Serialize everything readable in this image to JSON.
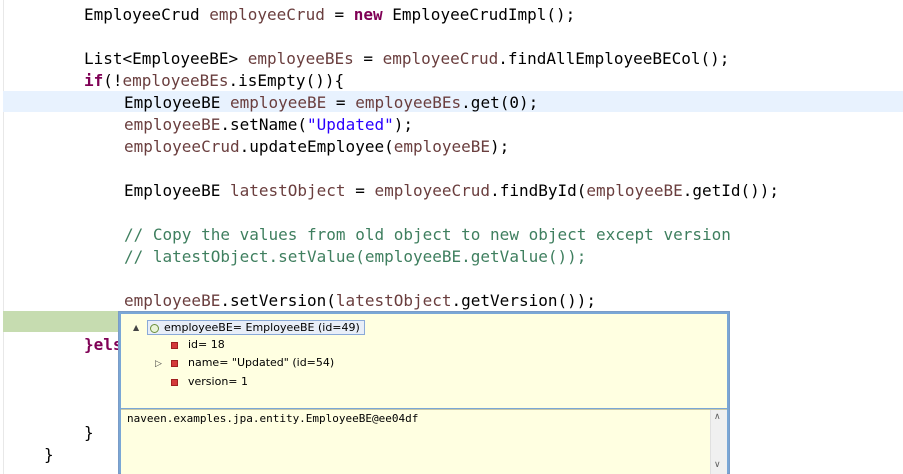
{
  "editor": {
    "lines": [
      {
        "segments": [
          {
            "t": "EmployeeCrud ",
            "c": ""
          },
          {
            "t": "employeeCrud",
            "c": "fld"
          },
          {
            "t": " = ",
            "c": ""
          },
          {
            "t": "new",
            "c": "kw"
          },
          {
            "t": " EmployeeCrudImpl();",
            "c": ""
          }
        ]
      },
      {
        "segments": [
          {
            "t": "List<EmployeeBE> ",
            "c": ""
          },
          {
            "t": "employeeBEs",
            "c": "fld"
          },
          {
            "t": " = ",
            "c": ""
          },
          {
            "t": "employeeCrud",
            "c": "fld"
          },
          {
            "t": ".findAllEmployeeBECol();",
            "c": ""
          }
        ]
      },
      {
        "segments": [
          {
            "t": "if",
            "c": "kw"
          },
          {
            "t": "(!",
            "c": ""
          },
          {
            "t": "employeeBEs",
            "c": "fld"
          },
          {
            "t": ".isEmpty()){",
            "c": ""
          }
        ]
      },
      {
        "segments": [
          {
            "t": "EmployeeBE ",
            "c": ""
          },
          {
            "t": "employeeBE",
            "c": "fld"
          },
          {
            "t": " = ",
            "c": ""
          },
          {
            "t": "employeeBEs",
            "c": "fld"
          },
          {
            "t": ".get(0);",
            "c": ""
          }
        ]
      },
      {
        "segments": [
          {
            "t": "employeeBE",
            "c": "fld"
          },
          {
            "t": ".setName(",
            "c": ""
          },
          {
            "t": "\"Updated\"",
            "c": "str"
          },
          {
            "t": ");",
            "c": ""
          }
        ]
      },
      {
        "segments": [
          {
            "t": "employeeCrud",
            "c": "fld"
          },
          {
            "t": ".updateEmployee(",
            "c": ""
          },
          {
            "t": "employeeBE",
            "c": "fld"
          },
          {
            "t": ");",
            "c": ""
          }
        ]
      },
      {
        "segments": [
          {
            "t": "EmployeeBE ",
            "c": ""
          },
          {
            "t": "latestObject",
            "c": "fld"
          },
          {
            "t": " = ",
            "c": ""
          },
          {
            "t": "employeeCrud",
            "c": "fld"
          },
          {
            "t": ".findById(",
            "c": ""
          },
          {
            "t": "employeeBE",
            "c": "fld"
          },
          {
            "t": ".getId());",
            "c": ""
          }
        ]
      },
      {
        "segments": [
          {
            "t": "// Copy the values from old object to new object except version",
            "c": "cmt"
          }
        ]
      },
      {
        "segments": [
          {
            "t": "// latestObject.setValue(employeeBE.getValue());",
            "c": "cmt"
          }
        ]
      },
      {
        "segments": [
          {
            "t": "employeeBE",
            "c": "fld"
          },
          {
            "t": ".setVersion(",
            "c": ""
          },
          {
            "t": "latestObject",
            "c": "fld"
          },
          {
            "t": ".getVersion());",
            "c": ""
          }
        ]
      },
      {
        "segments": [
          {
            "t": "}els",
            "c": "kw"
          }
        ]
      },
      {
        "segments": [
          {
            "t": "}",
            "c": ""
          }
        ]
      },
      {
        "segments": [
          {
            "t": "}",
            "c": ""
          }
        ]
      }
    ],
    "highlight_color": "#e8f2fe",
    "current_line_color": "#c6dcb0"
  },
  "popup": {
    "root_label": "employeeBE= EmployeeBE  (id=49)",
    "children": [
      {
        "label": "id= 18",
        "expandable": false
      },
      {
        "label": "name= \"Updated\" (id=54)",
        "expandable": true
      },
      {
        "label": "version= 1",
        "expandable": false
      }
    ],
    "detail_text": "naveen.examples.jpa.entity.EmployeeBE@ee04df",
    "expand_glyph": "▲",
    "collapsed_glyph": "▷",
    "scroll_up_glyph": "∧",
    "scroll_down_glyph": "∨"
  }
}
